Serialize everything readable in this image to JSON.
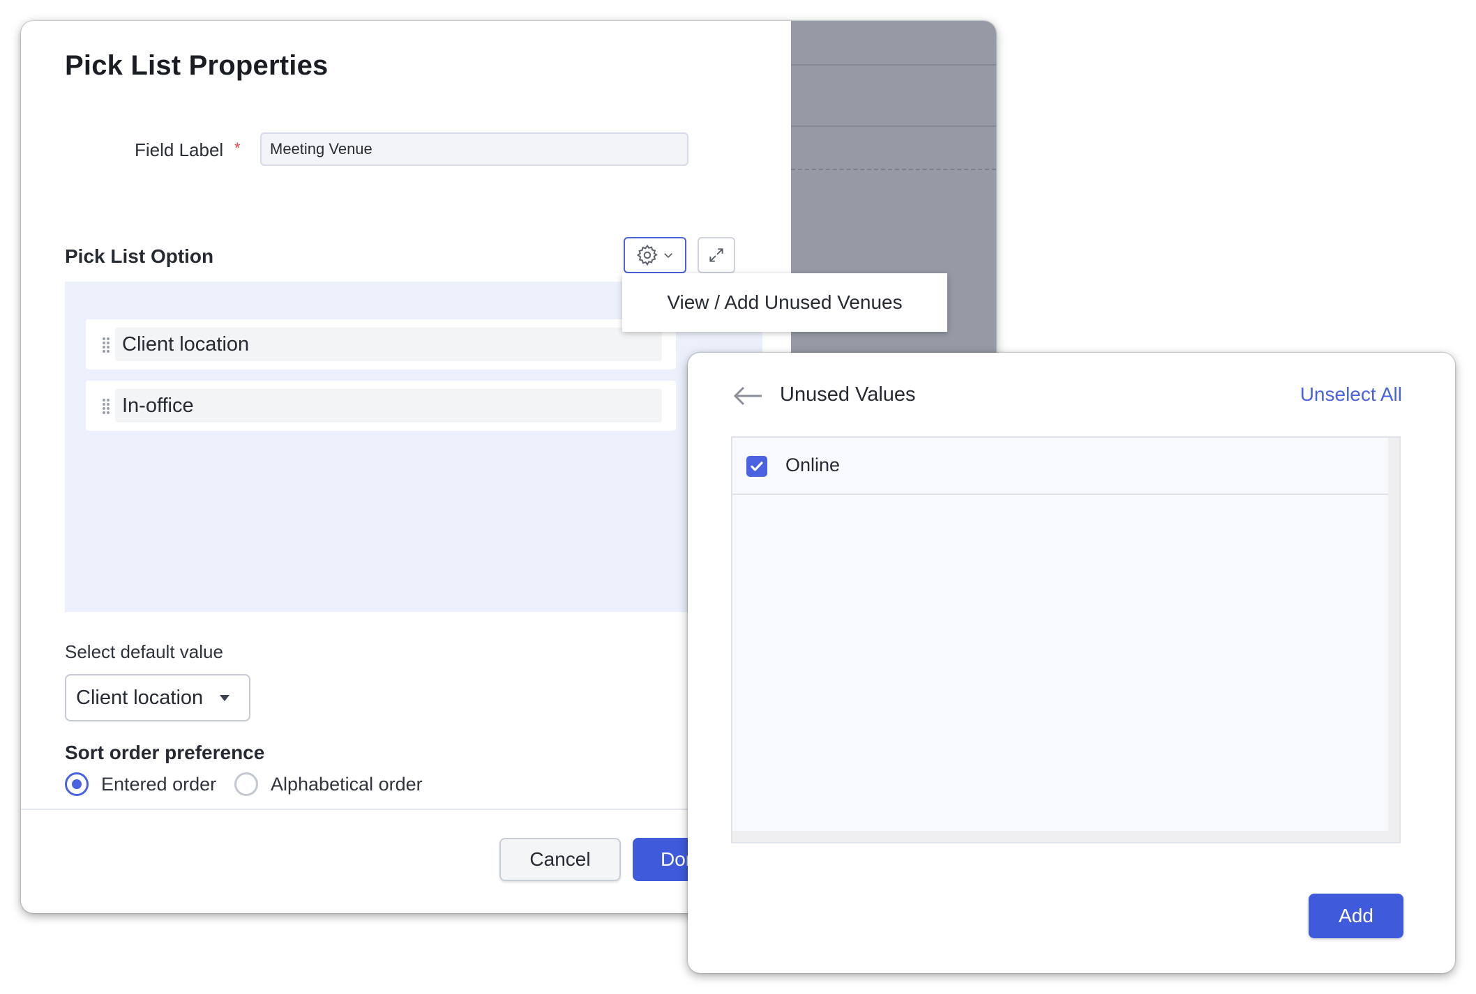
{
  "dialog": {
    "title": "Pick List Properties",
    "field_label": "Field Label",
    "required_marker": "*",
    "field_value": "Meeting Venue",
    "section_title": "Pick List Option",
    "options": [
      "Client location",
      "In-office"
    ],
    "default_label": "Select default value",
    "default_value": "Client location",
    "sort_label": "Sort order preference",
    "sort_options": [
      {
        "label": "Entered order",
        "checked": true
      },
      {
        "label": "Alphabetical order",
        "checked": false
      }
    ],
    "cancel_label": "Cancel",
    "done_label": "Done"
  },
  "menu": {
    "item_label": "View / Add Unused Venues"
  },
  "panel": {
    "title": "Unused Values",
    "unselect_all_label": "Unselect All",
    "values": [
      {
        "label": "Online",
        "checked": true
      }
    ],
    "add_label": "Add"
  },
  "colors": {
    "accent": "#4a62e0",
    "primary_button": "#3f5bdc",
    "backdrop": "#969aa5",
    "options_area": "#ecf0fb",
    "required": "#e5484d"
  },
  "icons": {
    "gear": "gear-icon",
    "chevron": "chevron-down-icon",
    "expand": "expand-icon",
    "grip": "drag-handle-icon",
    "back": "arrow-left-icon",
    "check": "check-icon",
    "caret": "caret-down-icon"
  }
}
